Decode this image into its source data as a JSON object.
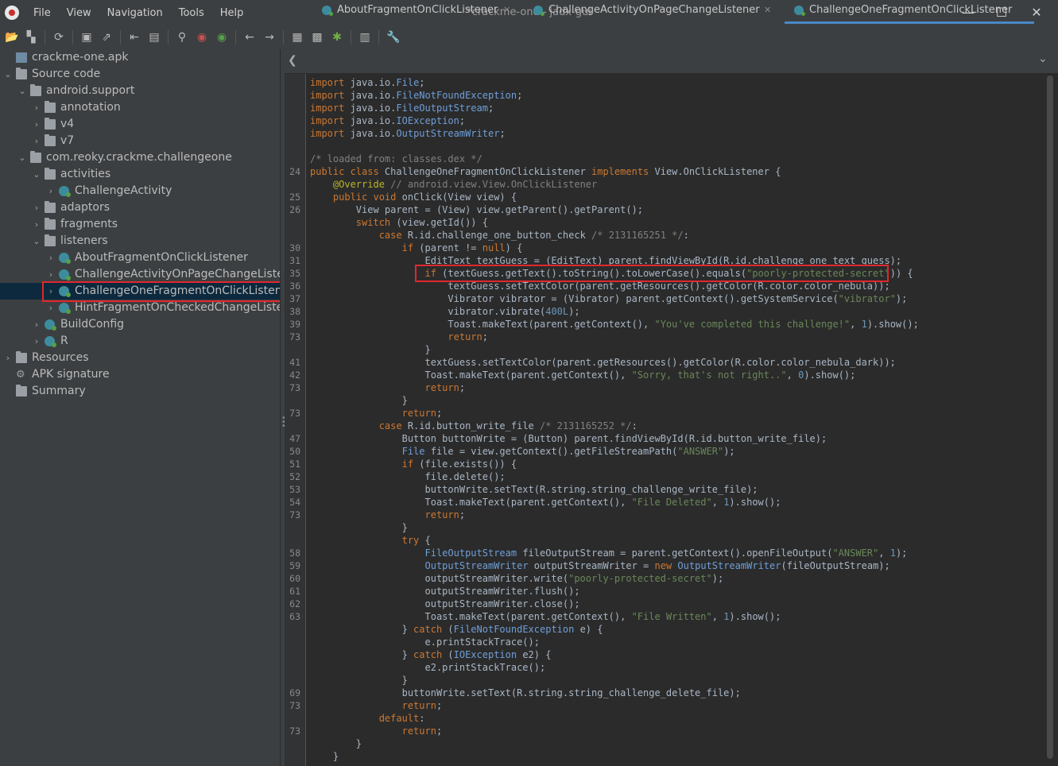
{
  "window": {
    "title": "*crackme-one - jadx-gui",
    "menu": [
      "File",
      "View",
      "Navigation",
      "Tools",
      "Help"
    ],
    "controls": {
      "minimize": "—",
      "maximize": "☐",
      "close": "✕"
    }
  },
  "toolbar": {
    "icons": [
      "open-file-icon",
      "add-files-icon",
      "reload-icon",
      "save-all-icon",
      "export-icon",
      "sync-tree-icon",
      "flat-packages-icon",
      "search-icon",
      "find-class-icon",
      "find-usage-icon",
      "back-icon",
      "forward-icon",
      "decompile-all-icon",
      "deobfuscation-icon",
      "log-icon",
      "preferences-icon"
    ]
  },
  "tree": {
    "nodes": [
      {
        "label": "crackme-one.apk",
        "depth": 0,
        "arrow": "",
        "icon": "apk"
      },
      {
        "label": "Source code",
        "depth": 0,
        "arrow": "v",
        "icon": "src"
      },
      {
        "label": "android.support",
        "depth": 1,
        "arrow": "v",
        "icon": "folder"
      },
      {
        "label": "annotation",
        "depth": 2,
        "arrow": ">",
        "icon": "folder"
      },
      {
        "label": "v4",
        "depth": 2,
        "arrow": ">",
        "icon": "folder"
      },
      {
        "label": "v7",
        "depth": 2,
        "arrow": ">",
        "icon": "folder"
      },
      {
        "label": "com.reoky.crackme.challengeone",
        "depth": 1,
        "arrow": "v",
        "icon": "folder"
      },
      {
        "label": "activities",
        "depth": 2,
        "arrow": "v",
        "icon": "folder"
      },
      {
        "label": "ChallengeActivity",
        "depth": 3,
        "arrow": ">",
        "icon": "class"
      },
      {
        "label": "adaptors",
        "depth": 2,
        "arrow": ">",
        "icon": "folder"
      },
      {
        "label": "fragments",
        "depth": 2,
        "arrow": ">",
        "icon": "folder"
      },
      {
        "label": "listeners",
        "depth": 2,
        "arrow": "v",
        "icon": "folder"
      },
      {
        "label": "AboutFragmentOnClickListener",
        "depth": 3,
        "arrow": ">",
        "icon": "class"
      },
      {
        "label": "ChallengeActivityOnPageChangeListener",
        "depth": 3,
        "arrow": ">",
        "icon": "class"
      },
      {
        "label": "ChallengeOneFragmentOnClickListener",
        "depth": 3,
        "arrow": ">",
        "icon": "class",
        "selected": true
      },
      {
        "label": "HintFragmentOnCheckedChangeListener",
        "depth": 3,
        "arrow": ">",
        "icon": "class"
      },
      {
        "label": "BuildConfig",
        "depth": 2,
        "arrow": ">",
        "icon": "class"
      },
      {
        "label": "R",
        "depth": 2,
        "arrow": ">",
        "icon": "class"
      },
      {
        "label": "Resources",
        "depth": 0,
        "arrow": ">",
        "icon": "folder"
      },
      {
        "label": "APK signature",
        "depth": 0,
        "arrow": "",
        "icon": "sig"
      },
      {
        "label": "Summary",
        "depth": 0,
        "arrow": "",
        "icon": "summary"
      }
    ]
  },
  "tabs": [
    {
      "label": "AboutFragmentOnClickListener",
      "close": "✕"
    },
    {
      "label": "ChallengeActivityOnPageChangeListener",
      "close": "✕"
    },
    {
      "label": "ChallengeOneFragmentOnClickListener",
      "active": true
    }
  ],
  "code": {
    "lines": [
      {
        "n": "",
        "t": "<span class='kw'>import</span> java.io.<span class='cls'>File</span>;"
      },
      {
        "n": "",
        "t": "<span class='kw'>import</span> java.io.<span class='cls'>FileNotFoundException</span>;"
      },
      {
        "n": "",
        "t": "<span class='kw'>import</span> java.io.<span class='cls'>FileOutputStream</span>;"
      },
      {
        "n": "",
        "t": "<span class='kw'>import</span> java.io.<span class='cls'>IOException</span>;"
      },
      {
        "n": "",
        "t": "<span class='kw'>import</span> java.io.<span class='cls'>OutputStreamWriter</span>;"
      },
      {
        "n": "",
        "t": ""
      },
      {
        "n": "",
        "t": "<span class='cmt'>/* loaded from: classes.dex */</span>"
      },
      {
        "n": "24",
        "t": "<span class='kw'>public class</span> ChallengeOneFragmentOnClickListener <span class='kw'>implements</span> View.OnClickListener {"
      },
      {
        "n": "",
        "t": "    <span class='ann'>@Override</span> <span class='cmt'>// android.view.View.OnClickListener</span>"
      },
      {
        "n": "25",
        "t": "    <span class='kw'>public void</span> onClick(View view) {"
      },
      {
        "n": "26",
        "t": "        View parent = (View) view.getParent().getParent();"
      },
      {
        "n": "",
        "t": "        <span class='kw'>switch</span> (view.getId()) {"
      },
      {
        "n": "",
        "t": "            <span class='kw'>case</span> R.id.challenge_one_button_check <span class='cmt'>/* 2131165251 */</span>:"
      },
      {
        "n": "30",
        "t": "                <span class='kw'>if</span> (parent != <span class='kw'>null</span>) {"
      },
      {
        "n": "31",
        "t": "                    EditText textGuess = (EditText) parent.findViewById(R.id.challenge_one_text_guess);"
      },
      {
        "n": "35",
        "t": "                    <span class='kw'>if</span> (textGuess.getText().toString().toLowerCase().equals(<span class='str'>\"poorly-protected-secret\"</span>)) {"
      },
      {
        "n": "36",
        "t": "                        textGuess.setTextColor(parent.getResources().getColor(R.color.color_nebula));"
      },
      {
        "n": "37",
        "t": "                        Vibrator vibrator = (Vibrator) parent.getContext().getSystemService(<span class='str'>\"vibrator\"</span>);"
      },
      {
        "n": "38",
        "t": "                        vibrator.vibrate(<span class='num'>400L</span>);"
      },
      {
        "n": "39",
        "t": "                        Toast.makeText(parent.getContext(), <span class='str'>\"You've completed this challenge!\"</span>, <span class='num'>1</span>).show();"
      },
      {
        "n": "73",
        "t": "                        <span class='kw'>return</span>;"
      },
      {
        "n": "",
        "t": "                    }"
      },
      {
        "n": "41",
        "t": "                    textGuess.setTextColor(parent.getResources().getColor(R.color.color_nebula_dark));"
      },
      {
        "n": "42",
        "t": "                    Toast.makeText(parent.getContext(), <span class='str'>\"Sorry, that's not right..\"</span>, <span class='num'>0</span>).show();"
      },
      {
        "n": "73",
        "t": "                    <span class='kw'>return</span>;"
      },
      {
        "n": "",
        "t": "                }"
      },
      {
        "n": "73",
        "t": "                <span class='kw'>return</span>;"
      },
      {
        "n": "",
        "t": "            <span class='kw'>case</span> R.id.button_write_file <span class='cmt'>/* 2131165252 */</span>:"
      },
      {
        "n": "47",
        "t": "                Button buttonWrite = (Button) parent.findViewById(R.id.button_write_file);"
      },
      {
        "n": "50",
        "t": "                <span class='cls'>File</span> file = view.getContext().getFileStreamPath(<span class='str'>\"ANSWER\"</span>);"
      },
      {
        "n": "51",
        "t": "                <span class='kw'>if</span> (file.exists()) {"
      },
      {
        "n": "52",
        "t": "                    file.delete();"
      },
      {
        "n": "53",
        "t": "                    buttonWrite.setText(R.string.string_challenge_write_file);"
      },
      {
        "n": "54",
        "t": "                    Toast.makeText(parent.getContext(), <span class='str'>\"File Deleted\"</span>, <span class='num'>1</span>).show();"
      },
      {
        "n": "73",
        "t": "                    <span class='kw'>return</span>;"
      },
      {
        "n": "",
        "t": "                }"
      },
      {
        "n": "",
        "t": "                <span class='kw'>try</span> {"
      },
      {
        "n": "58",
        "t": "                    <span class='cls'>FileOutputStream</span> fileOutputStream = parent.getContext().openFileOutput(<span class='str'>\"ANSWER\"</span>, <span class='num'>1</span>);"
      },
      {
        "n": "59",
        "t": "                    <span class='cls'>OutputStreamWriter</span> outputStreamWriter = <span class='kw'>new</span> <span class='cls'>OutputStreamWriter</span>(fileOutputStream);"
      },
      {
        "n": "60",
        "t": "                    outputStreamWriter.write(<span class='str'>\"poorly-protected-secret\"</span>);"
      },
      {
        "n": "61",
        "t": "                    outputStreamWriter.flush();"
      },
      {
        "n": "62",
        "t": "                    outputStreamWriter.close();"
      },
      {
        "n": "63",
        "t": "                    Toast.makeText(parent.getContext(), <span class='str'>\"File Written\"</span>, <span class='num'>1</span>).show();"
      },
      {
        "n": "",
        "t": "                } <span class='kw'>catch</span> (<span class='cls'>FileNotFoundException</span> e) {"
      },
      {
        "n": "",
        "t": "                    e.printStackTrace();"
      },
      {
        "n": "",
        "t": "                } <span class='kw'>catch</span> (<span class='cls'>IOException</span> e2) {"
      },
      {
        "n": "",
        "t": "                    e2.printStackTrace();"
      },
      {
        "n": "",
        "t": "                }"
      },
      {
        "n": "69",
        "t": "                buttonWrite.setText(R.string.string_challenge_delete_file);"
      },
      {
        "n": "73",
        "t": "                <span class='kw'>return</span>;"
      },
      {
        "n": "",
        "t": "            <span class='kw'>default</span>:"
      },
      {
        "n": "73",
        "t": "                <span class='kw'>return</span>;"
      },
      {
        "n": "",
        "t": "        }"
      },
      {
        "n": "",
        "t": "    }"
      }
    ]
  }
}
